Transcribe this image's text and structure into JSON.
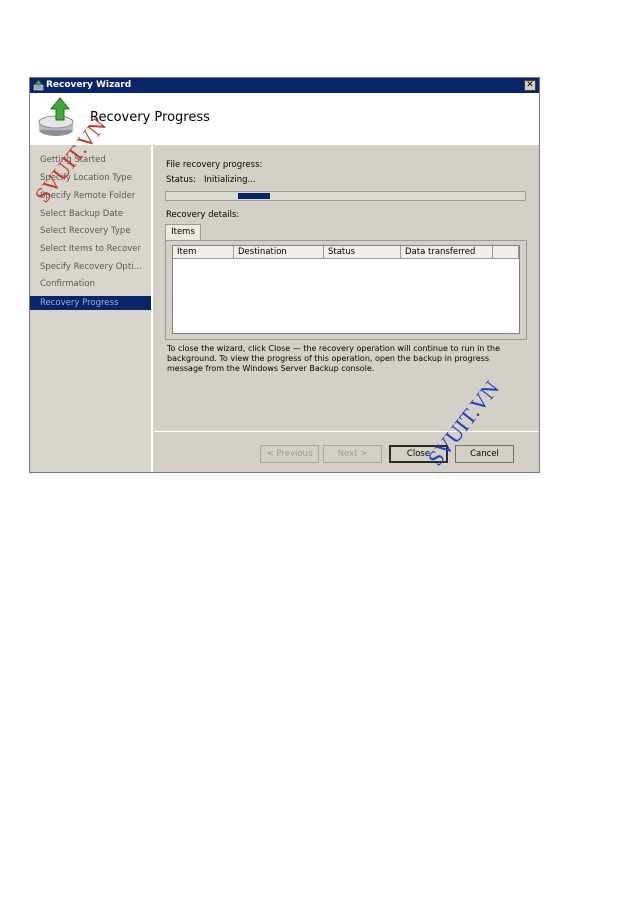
{
  "window": {
    "title": "Recovery Wizard",
    "close_glyph": "✕"
  },
  "header": {
    "title": "Recovery Progress"
  },
  "sidebar": {
    "items": [
      {
        "label": "Getting Started"
      },
      {
        "label": "Specify Location Type"
      },
      {
        "label": "Specify Remote Folder"
      },
      {
        "label": "Select Backup Date"
      },
      {
        "label": "Select Recovery Type"
      },
      {
        "label": "Select Items to Recover"
      },
      {
        "label": "Specify Recovery Opti..."
      },
      {
        "label": "Confirmation"
      },
      {
        "label": "Recovery Progress"
      }
    ],
    "active_index": 8
  },
  "progress": {
    "heading": "File recovery progress:",
    "status_label": "Status:",
    "status_value": "Initializing...",
    "fill_start": 0.2,
    "fill_fraction": 0.09
  },
  "details": {
    "heading": "Recovery details:",
    "tab_label": "Items",
    "columns": [
      "Item",
      "Destination",
      "Status",
      "Data transferred"
    ]
  },
  "info_text": "To close the wizard, click Close — the recovery operation will continue to run in the background. To view the progress of this operation, open the backup in progress message from the Windows Server Backup console.",
  "buttons": {
    "previous": "< Previous",
    "next": "Next >",
    "close": "Close",
    "cancel": "Cancel"
  },
  "watermarks": [
    {
      "text": "SVUIT.VN",
      "color": "#c0392b"
    },
    {
      "text": "SVUIT.VN",
      "color": "#1f3fbf"
    }
  ]
}
